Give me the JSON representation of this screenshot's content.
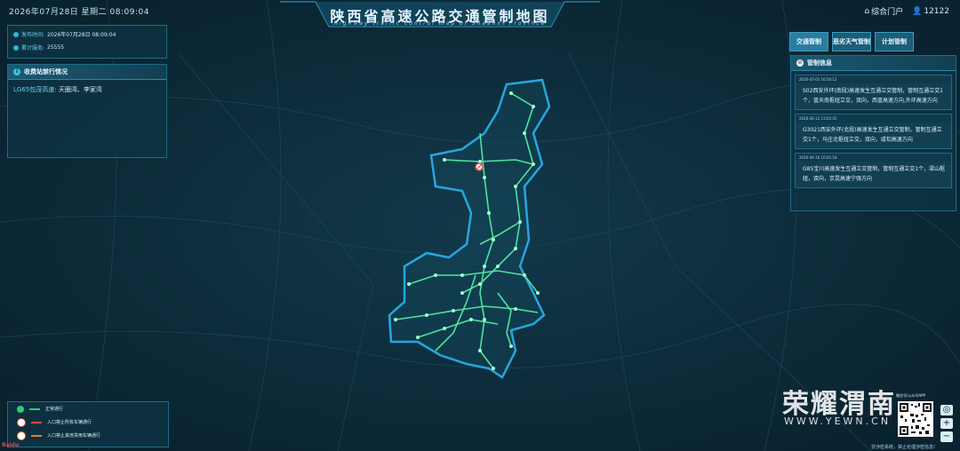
{
  "header": {
    "datetime": "2026年07月28日 星期二 08:09:04",
    "title": "陕西省高速公路交通管制地图",
    "subtitle": "Highway traffic control map of Shaanxi Province",
    "portal_label": "综合门户",
    "user_id": "12122"
  },
  "info": {
    "publish_label": "发布时间:",
    "publish_value": "2026年07月28日 08:09:04",
    "count_label": "累计服务:",
    "count_value": "25555"
  },
  "toll": {
    "title": "收费站禁行情况",
    "road": "LG65包茂高速:",
    "stations": "天圈湾、李家湾"
  },
  "tabs": [
    {
      "label": "交通管制"
    },
    {
      "label": "恶劣天气管制"
    },
    {
      "label": "计划管制"
    }
  ],
  "control": {
    "title": "管制信息",
    "messages": [
      {
        "time": "2026-07-01 16:56:12",
        "text": "S02西安外环(南段)高速发生互通立交管制，管制互通立交1个，蓝天南枢纽立交，双向，西蓝高速方向,外环高速方向"
      },
      {
        "time": "2026-06-12 13:02:05",
        "text": "G3021西安外环(北段)高速发生互通立交管制，管制互通立交1个，马庄北枢纽立交，双向，咸旬高速方向"
      },
      {
        "time": "2026-04-16 10:01:18",
        "text": "G85宝川高速发生互通立交管制，管制互通立交1个，梁山枢纽，双向，京昆高速宁强方向"
      }
    ]
  },
  "legend": [
    {
      "label": "正常通行",
      "icon_color": "#2ecc71",
      "bar_color": "#2ecc71"
    },
    {
      "label": "入口禁止所有车辆通行",
      "icon_color": "#e74c3c",
      "bar_color": "#e74c3c"
    },
    {
      "label": "入口禁止其他货用车辆通行",
      "icon_color": "#e67e22",
      "bar_color": "#e67e22"
    }
  ],
  "watermark": {
    "brand": "荣耀渭南",
    "url": "WWW.YEWN.CN",
    "qr_label": "微信号/公众号APP"
  },
  "footer": {
    "note": "非涉密系统，禁止处理涉密信息!",
    "map_logo": "Baidu"
  },
  "colors": {
    "road_network": "#4de3a0",
    "province_border": "#27a6e0",
    "accent": "#3cc3ea"
  }
}
